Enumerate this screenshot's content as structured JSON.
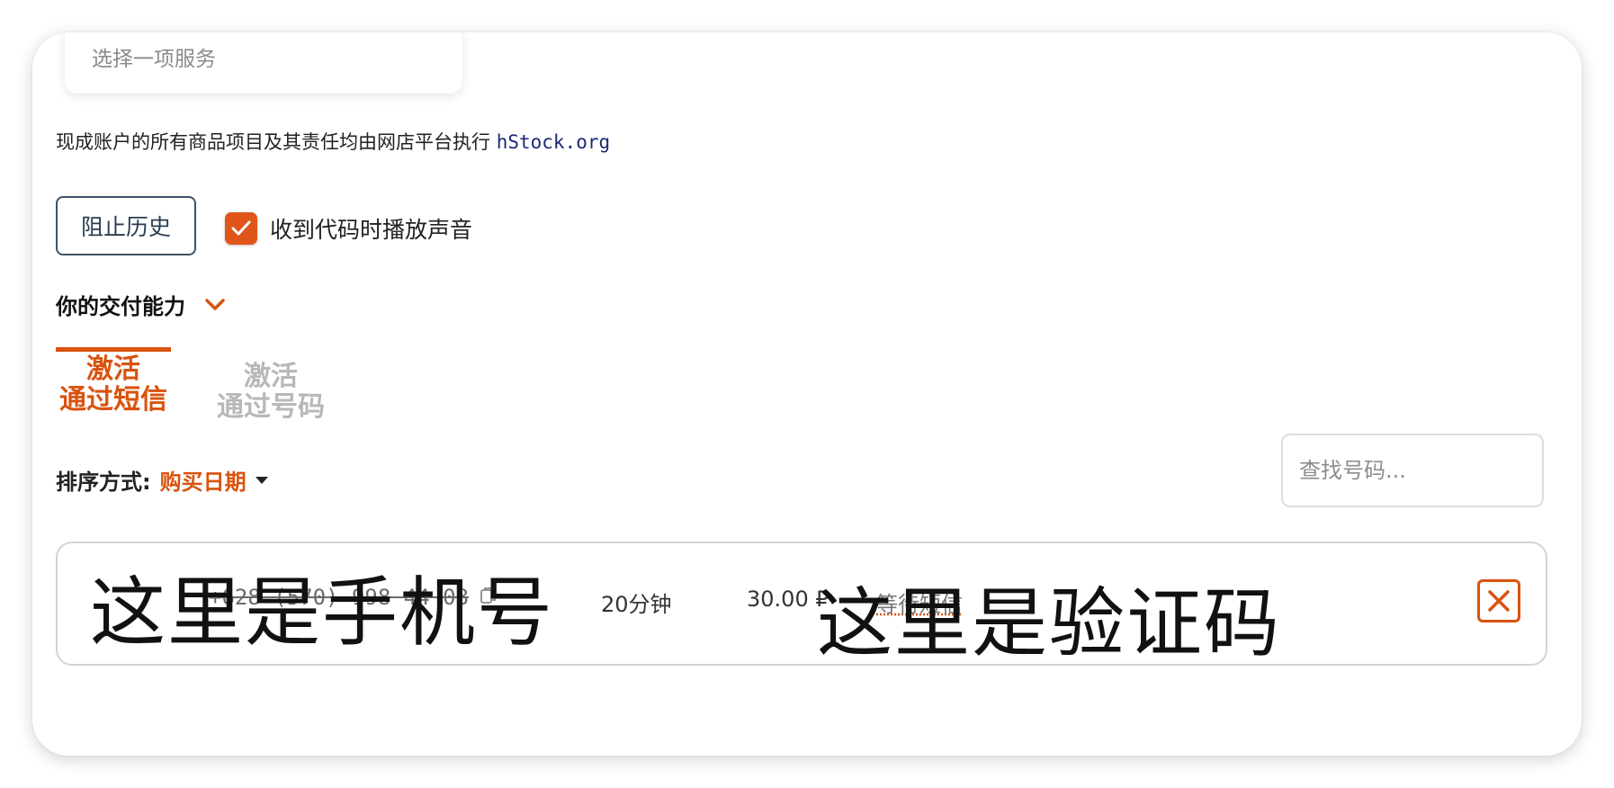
{
  "service_select": {
    "placeholder": "选择一项服务"
  },
  "responsibility": {
    "text": "现成账户的所有商品项目及其责任均由网店平台执行 ",
    "link": "hStock.org"
  },
  "controls": {
    "block_history_label": "阻止历史",
    "sound_label": "收到代码时播放声音",
    "sound_checked": true
  },
  "delivery": {
    "label": "你的交付能力"
  },
  "tabs": [
    {
      "line1": "激活",
      "line2": "通过短信",
      "active": true
    },
    {
      "line1": "激活",
      "line2": "通过号码",
      "active": false
    }
  ],
  "sort": {
    "label": "排序方式:",
    "value": "购买日期"
  },
  "search": {
    "placeholder": "查找号码..."
  },
  "order": {
    "phone": "+628 (570) 998 44 08",
    "phone_overlay": "这里是手机号",
    "duration": "20分钟",
    "price": "30.00 ₽",
    "status": "等待短信",
    "code_overlay": "这里是验证码"
  },
  "colors": {
    "accent": "#d9530f",
    "link": "#1d2a73",
    "inactive_tab": "#b8b8b8"
  }
}
